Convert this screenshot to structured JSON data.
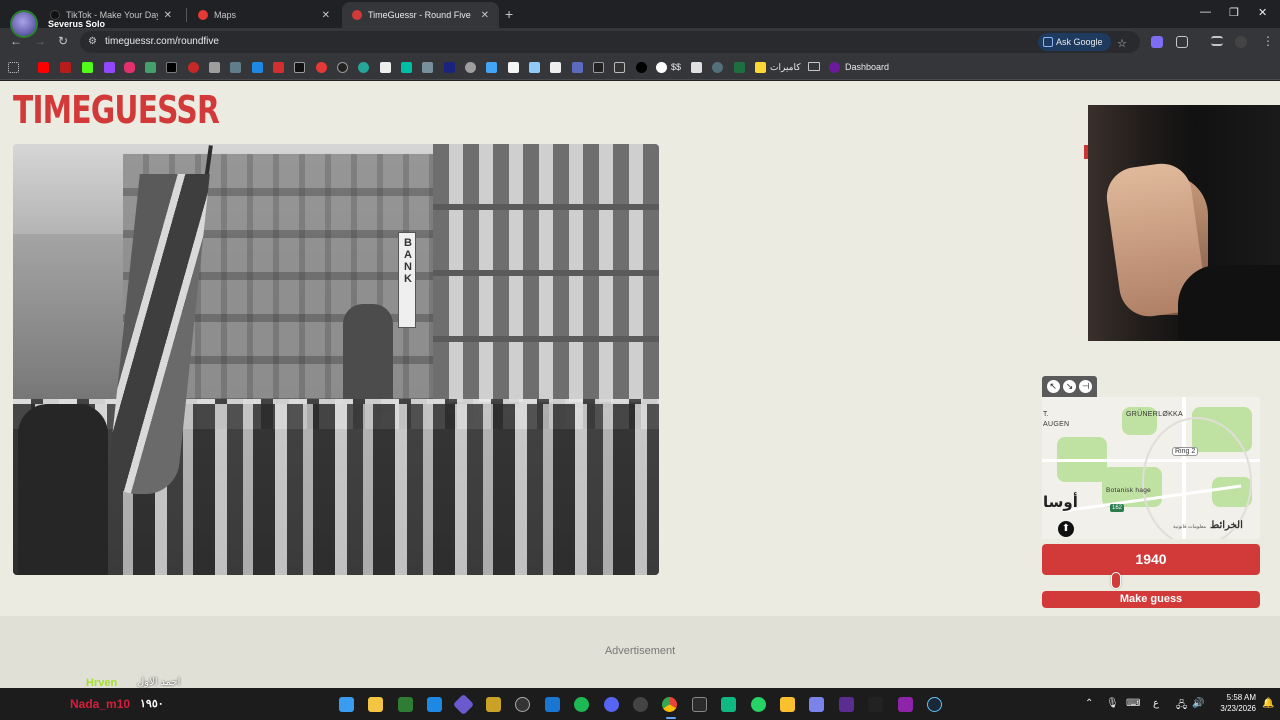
{
  "browser": {
    "tabs": [
      {
        "title": "TikTok - Make Your Day",
        "favicon_color": "#111111",
        "active": false
      },
      {
        "title": "Maps",
        "favicon_color": "#e53935",
        "active": false
      },
      {
        "title": "TimeGuessr - Round Five",
        "favicon_color": "#d23a3a",
        "active": true
      }
    ],
    "profile_name": "Severus Solo",
    "url": "timeguessr.com/roundfive",
    "ask_google": "Ask Google",
    "bookmarks": {
      "arabic_label": "كاميرات",
      "dollars_label": "$$",
      "folder_label": "Dashboard"
    }
  },
  "game": {
    "logo": "TIMEGUESSR",
    "photo": {
      "sign_text": "BANK"
    },
    "map": {
      "labels": [
        "GRÜNERLØKKA",
        "T.",
        "AUGEN",
        "Botanisk hage"
      ],
      "ring_label": "Ring 2",
      "road_number": "162",
      "arabic_city": "أوسا",
      "brand": "الخرائط",
      "legal": "معلومات قانونية",
      "pin_icon": "compass-icon"
    },
    "year_value": "1940",
    "slider_fraction": 0.33,
    "guess_button": "Make guess",
    "advertisement": "Advertisement"
  },
  "stream_overlay": {
    "user1": "Hrven",
    "user1_msg": "احمد الاول",
    "user2": "Nada_m10",
    "user2_msg": "١٩٥٠"
  },
  "taskbar": {
    "time": "5:58 AM",
    "date": "3/23/2026",
    "lang": "ع"
  },
  "colors": {
    "accent": "#d23a3a",
    "page_bg": "#ebebe1"
  }
}
